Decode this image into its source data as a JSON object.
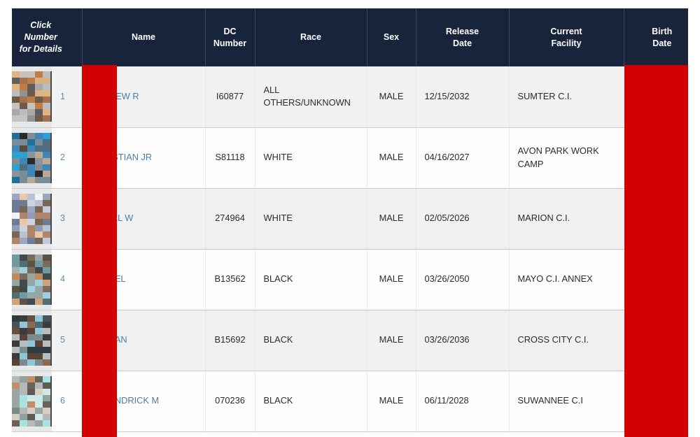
{
  "table": {
    "headers": [
      {
        "id": "click-number",
        "label_lines": [
          "Click",
          "Number",
          "for Details"
        ]
      },
      {
        "id": "name",
        "label_lines": [
          "Name"
        ]
      },
      {
        "id": "dc-number",
        "label_lines": [
          "DC",
          "Number"
        ]
      },
      {
        "id": "race",
        "label_lines": [
          "Race"
        ]
      },
      {
        "id": "sex",
        "label_lines": [
          "Sex"
        ]
      },
      {
        "id": "release-date",
        "label_lines": [
          "Release",
          "Date"
        ]
      },
      {
        "id": "current-facility",
        "label_lines": [
          "Current",
          "Facility"
        ]
      },
      {
        "id": "birth-date",
        "label_lines": [
          "Birth",
          "Date"
        ]
      }
    ],
    "rows": [
      {
        "number": "1",
        "name": "ANDREW R",
        "dc_number": "I60877",
        "race": "ALL OTHERS/UNKNOWN",
        "sex": "MALE",
        "release_date": "12/15/2032",
        "facility": "SUMTER C.I.",
        "birth_date": ""
      },
      {
        "number": "2",
        "name": "CHRISTIAN JR",
        "dc_number": "S81118",
        "race": "WHITE",
        "sex": "MALE",
        "release_date": "04/16/2027",
        "facility": "AVON PARK WORK CAMP",
        "birth_date": ""
      },
      {
        "number": "3",
        "name": "DANIEL W",
        "dc_number": "274964",
        "race": "WHITE",
        "sex": "MALE",
        "release_date": "02/05/2026",
        "facility": "MARION C.I.",
        "birth_date": ""
      },
      {
        "number": "4",
        "name": "FEDNEL",
        "dc_number": "B13562",
        "race": "BLACK",
        "sex": "MALE",
        "release_date": "03/26/2050",
        "facility": "MAYO C.I. ANNEX",
        "birth_date": ""
      },
      {
        "number": "5",
        "name": "LEQUAN",
        "dc_number": "B15692",
        "race": "BLACK",
        "sex": "MALE",
        "release_date": "03/26/2036",
        "facility": "CROSS CITY C.I.",
        "birth_date": ""
      },
      {
        "number": "6",
        "name": "LILKENDRICK M",
        "dc_number": "070236",
        "race": "BLACK",
        "sex": "MALE",
        "release_date": "06/11/2028",
        "facility": "SUWANNEE C.I",
        "birth_date": ""
      }
    ]
  },
  "colors": {
    "header_background": "#18233c",
    "header_text": "#ffffff",
    "link_text": "#4a7fa5",
    "redaction_bar": "#d20202",
    "row_odd_background": "#f1f1f1",
    "row_even_background": "#fefefe"
  }
}
